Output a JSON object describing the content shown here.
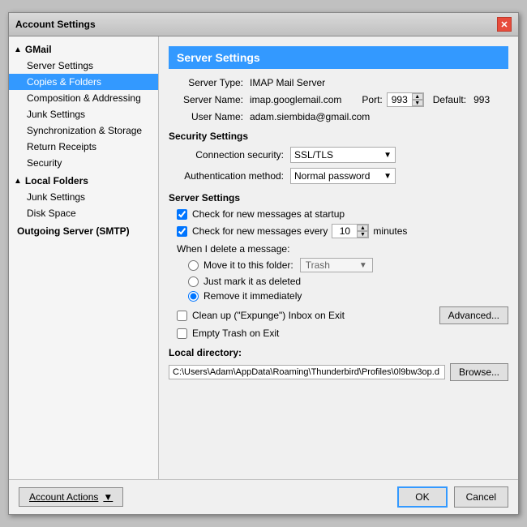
{
  "window": {
    "title": "Account Settings"
  },
  "sidebar": {
    "groups": [
      {
        "label": "GMail",
        "expanded": true,
        "items": [
          {
            "id": "server-settings",
            "label": "Server Settings",
            "selected": false
          },
          {
            "id": "copies-folders",
            "label": "Copies & Folders",
            "selected": true
          },
          {
            "id": "composition",
            "label": "Composition & Addressing",
            "selected": false
          },
          {
            "id": "junk",
            "label": "Junk Settings",
            "selected": false
          },
          {
            "id": "sync",
            "label": "Synchronization & Storage",
            "selected": false
          },
          {
            "id": "receipts",
            "label": "Return Receipts",
            "selected": false
          },
          {
            "id": "security",
            "label": "Security",
            "selected": false
          }
        ]
      },
      {
        "label": "Local Folders",
        "expanded": true,
        "items": [
          {
            "id": "local-junk",
            "label": "Junk Settings",
            "selected": false
          },
          {
            "id": "disk-space",
            "label": "Disk Space",
            "selected": false
          }
        ]
      },
      {
        "label": "Outgoing Server (SMTP)",
        "expanded": false,
        "items": []
      }
    ]
  },
  "panel": {
    "title": "Server Settings",
    "server_type_label": "Server Type:",
    "server_type_value": "IMAP Mail Server",
    "server_name_label": "Server Name:",
    "server_name_value": "imap.googlemail.com",
    "port_label": "Port:",
    "port_value": "993",
    "default_label": "Default:",
    "default_value": "993",
    "username_label": "User Name:",
    "username_value": "adam.siembida@gmail.com",
    "security_settings_title": "Security Settings",
    "connection_security_label": "Connection security:",
    "connection_security_value": "SSL/TLS",
    "auth_method_label": "Authentication method:",
    "auth_method_value": "Normal password",
    "server_settings_title": "Server Settings",
    "check_new_startup": "Check for new messages at startup",
    "check_new_every": "Check for new messages every",
    "check_interval": "10",
    "check_interval_unit": "minutes",
    "delete_message_label": "When I delete a message:",
    "move_folder_label": "Move it to this folder:",
    "folder_name": "Trash",
    "just_mark_label": "Just mark it as deleted",
    "remove_immediately_label": "Remove it immediately",
    "cleanup_label": "Clean up (\"Expunge\") Inbox on Exit",
    "empty_trash_label": "Empty Trash on Exit",
    "advanced_btn": "Advanced...",
    "local_directory_label": "Local directory:",
    "local_directory_value": "C:\\Users\\Adam\\AppData\\Roaming\\Thunderbird\\Profiles\\0l9bw3op.d",
    "browse_btn": "Browse..."
  },
  "bottom": {
    "account_actions_label": "Account Actions",
    "account_actions_arrow": "▼",
    "ok_btn": "OK",
    "cancel_btn": "Cancel"
  }
}
